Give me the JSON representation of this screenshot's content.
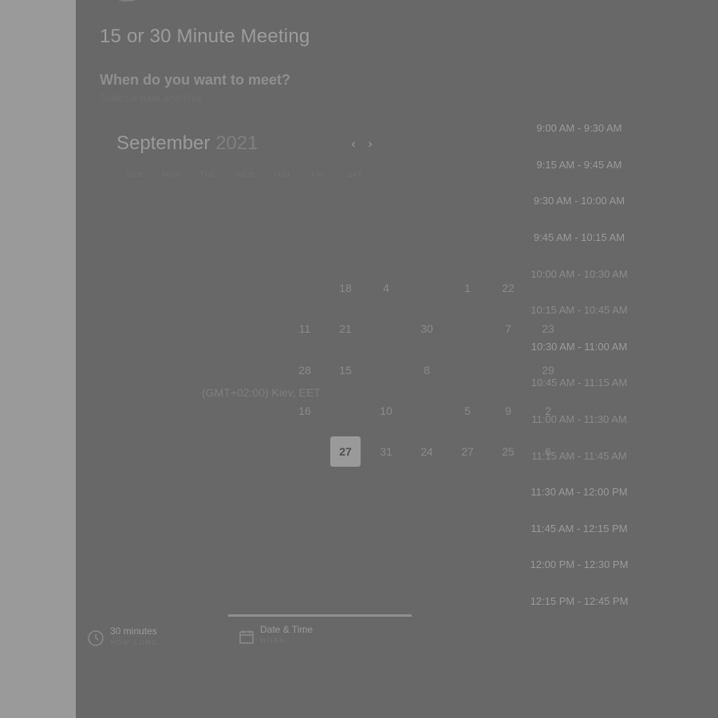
{
  "meeting": {
    "title": "15 or 30 Minute Meeting",
    "question": "When do you want to meet?",
    "hint": "Select a date and time"
  },
  "calendar": {
    "month": "September",
    "year": "2021",
    "weekdays": [
      "SUN",
      "MON",
      "TUE",
      "WED",
      "THU",
      "FRI",
      "SAT"
    ],
    "days_visible": [
      {
        "label": "18",
        "highlight": false
      },
      {
        "label": "4",
        "highlight": false
      },
      {
        "label": "1",
        "highlight": false
      },
      {
        "label": "22",
        "highlight": false
      },
      {
        "label": "11",
        "highlight": false
      },
      {
        "label": "21",
        "highlight": false
      },
      {
        "label": "30",
        "highlight": false
      },
      {
        "label": "7",
        "highlight": false
      },
      {
        "label": "23",
        "highlight": false
      },
      {
        "label": "28",
        "highlight": false
      },
      {
        "label": "15",
        "highlight": false
      },
      {
        "label": "8",
        "highlight": false
      },
      {
        "label": "29",
        "highlight": false
      },
      {
        "label": "16",
        "highlight": false
      },
      {
        "label": "10",
        "highlight": false
      },
      {
        "label": "5",
        "highlight": false
      },
      {
        "label": "9",
        "highlight": false
      },
      {
        "label": "2",
        "highlight": false
      },
      {
        "label": "27",
        "highlight": true
      },
      {
        "label": "31",
        "highlight": false
      },
      {
        "label": "24",
        "highlight": false
      },
      {
        "label": "27",
        "highlight": false
      },
      {
        "label": "25",
        "highlight": false
      },
      {
        "label": "6",
        "highlight": false
      }
    ],
    "timezone": "(GMT+02:00) Kiev, EET"
  },
  "time_slots": [
    "9:00 AM - 9:30 AM",
    "9:15 AM - 9:45 AM",
    "9:30 AM - 10:00 AM",
    "9:45 AM - 10:15 AM",
    "10:00 AM - 10:30 AM",
    "10:15 AM - 10:45 AM",
    "10:30 AM - 11:00 AM",
    "10:45 AM - 11:15 AM",
    "11:00 AM - 11:30 AM",
    "11:15 AM - 11:45 AM",
    "11:30 AM - 12:00 PM",
    "11:45 AM - 12:15 PM",
    "12:00 PM - 12:30 PM",
    "12:15 PM - 12:45 PM"
  ],
  "footer": {
    "duration": {
      "label": "30 minutes",
      "sub": "HOW LONG",
      "icon": "clock-icon"
    },
    "datetime": {
      "label": "Date & Time",
      "sub": "WHEN",
      "icon": "calendar-icon"
    }
  },
  "colors": {
    "overlay_main": "#686868",
    "overlay_side": "#9a9a9a",
    "selected_day": "#9a9a9a"
  }
}
